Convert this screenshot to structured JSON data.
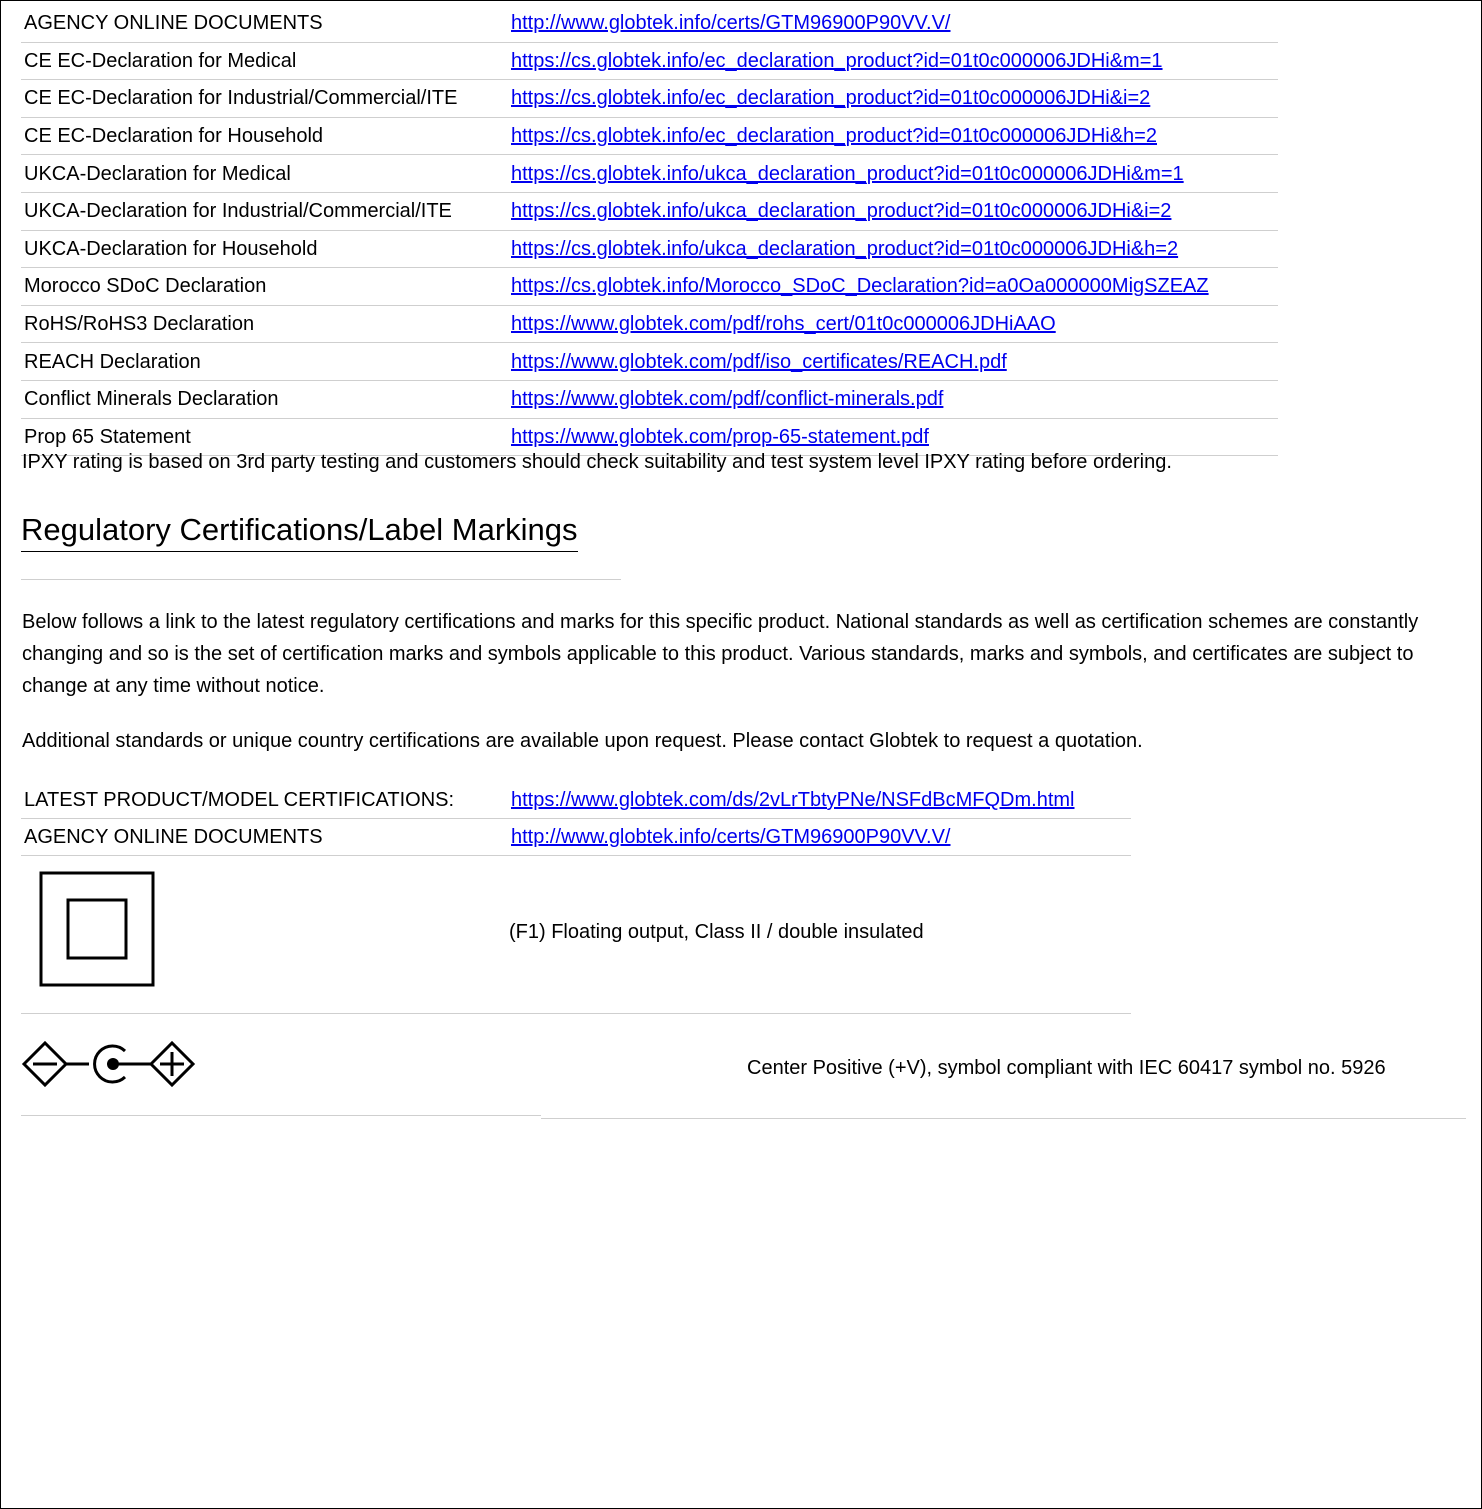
{
  "agency_table": [
    {
      "label": "AGENCY ONLINE DOCUMENTS",
      "link": "http://www.globtek.info/certs/GTM96900P90VV.V/"
    },
    {
      "label": "CE EC-Declaration for Medical",
      "link": "https://cs.globtek.info/ec_declaration_product?id=01t0c000006JDHi&m=1"
    },
    {
      "label": "CE EC-Declaration for Industrial/Commercial/ITE",
      "link": "https://cs.globtek.info/ec_declaration_product?id=01t0c000006JDHi&i=2"
    },
    {
      "label": "CE EC-Declaration for Household",
      "link": "https://cs.globtek.info/ec_declaration_product?id=01t0c000006JDHi&h=2"
    },
    {
      "label": "UKCA-Declaration for Medical",
      "link": "https://cs.globtek.info/ukca_declaration_product?id=01t0c000006JDHi&m=1"
    },
    {
      "label": "UKCA-Declaration for Industrial/Commercial/ITE",
      "link": "https://cs.globtek.info/ukca_declaration_product?id=01t0c000006JDHi&i=2"
    },
    {
      "label": "UKCA-Declaration for Household",
      "link": "https://cs.globtek.info/ukca_declaration_product?id=01t0c000006JDHi&h=2"
    },
    {
      "label": "Morocco SDoC Declaration",
      "link": "https://cs.globtek.info/Morocco_SDoC_Declaration?id=a0Oa000000MigSZEAZ"
    },
    {
      "label": "RoHS/RoHS3 Declaration",
      "link": "https://www.globtek.com/pdf/rohs_cert/01t0c000006JDHiAAO"
    },
    {
      "label": "REACH Declaration",
      "link": "https://www.globtek.com/pdf/iso_certificates/REACH.pdf"
    },
    {
      "label": "Conflict Minerals Declaration",
      "link": "https://www.globtek.com/pdf/conflict-minerals.pdf"
    },
    {
      "label": "Prop 65 Statement",
      "link": "https://www.globtek.com/prop-65-statement.pdf"
    }
  ],
  "ipxy_note": "IPXY rating is based on 3rd party testing and customers should check suitability and test system level IPXY rating before ordering.",
  "section_title": "Regulatory Certifications/Label Markings",
  "paragraph_1": "Below follows a link to the latest regulatory certifications and marks for this specific product. National standards as well as certification schemes are constantly changing and so is the set of certification marks and symbols applicable to this product. Various standards, marks and symbols, and certificates are subject to change at any time without notice.",
  "paragraph_2": "Additional standards or unique country certifications are available upon request. Please contact Globtek to request a quotation.",
  "cert_table": [
    {
      "label": "LATEST PRODUCT/MODEL CERTIFICATIONS:",
      "link": "https://www.globtek.com/ds/2vLrTbtyPNe/NSFdBcMFQDm.html"
    },
    {
      "label": "AGENCY ONLINE DOCUMENTS",
      "link": "http://www.globtek.info/certs/GTM96900P90VV.V/"
    }
  ],
  "marks": {
    "class2_icon": "double-square-class-ii-icon",
    "class2_text": "(F1) Floating output, Class II / double insulated",
    "polarity_icon": "center-positive-polarity-icon",
    "polarity_text": "Center Positive (+V), symbol compliant with IEC 60417 symbol no. 5926"
  },
  "colors": {
    "link": "#0000ee",
    "rule": "#cfcfcf",
    "text": "#000000"
  }
}
